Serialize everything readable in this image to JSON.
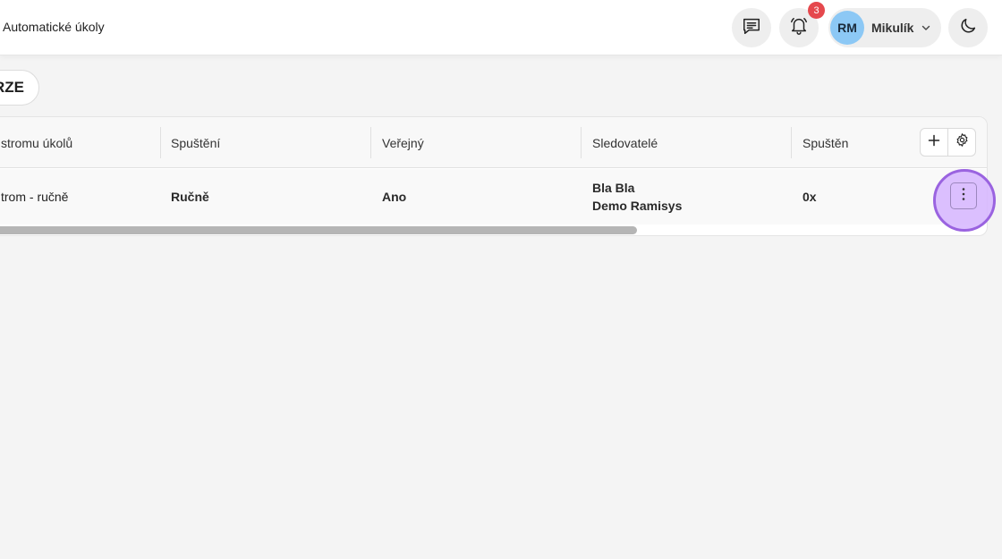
{
  "header": {
    "breadcrumb": "Automatické úkoly",
    "notification_count": "3",
    "user": {
      "initials": "RM",
      "name": "Mikulík"
    }
  },
  "toolbar": {
    "version_button_label": "RZE"
  },
  "table": {
    "columns": [
      "stromu úkolů",
      "Spuštění",
      "Veřejný",
      "Sledovatelé",
      "Spuštěn"
    ],
    "rows": [
      {
        "name": "trom - ručně",
        "trigger": "Ručně",
        "public": "Ano",
        "followers": [
          "Bla Bla",
          "Demo Ramisys"
        ],
        "runs": "0x"
      }
    ]
  },
  "colors": {
    "badge": "#e5484d",
    "avatar": "#8cc8f5",
    "highlight": "#d6b5ff",
    "highlight_border": "#9a63e0"
  },
  "icons": [
    "message-list-icon",
    "bell-icon",
    "chevron-down-icon",
    "moon-icon",
    "plus-icon",
    "gear-icon",
    "kebab-menu-icon"
  ]
}
